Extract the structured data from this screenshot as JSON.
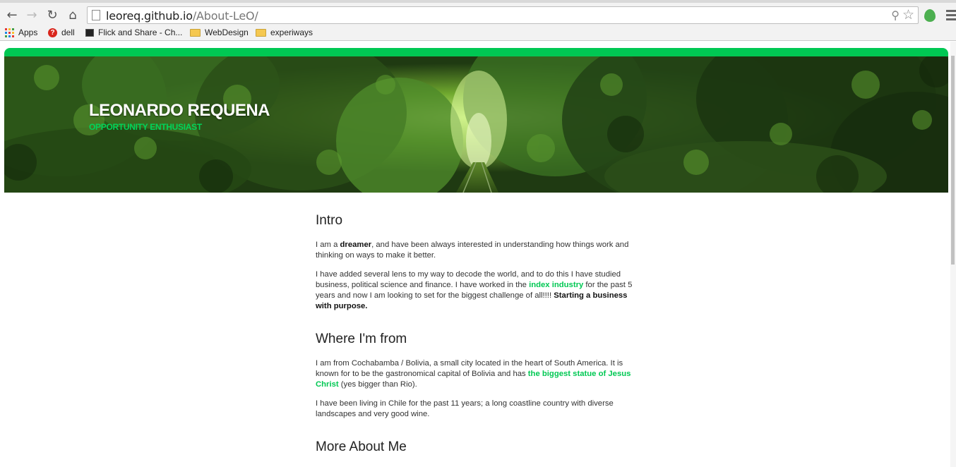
{
  "browser": {
    "url_host": "leoreq.github.io",
    "url_path": "/About-LeO/"
  },
  "bookmarks": {
    "apps": "Apps",
    "dell": "dell",
    "flick": "Flick and Share - Ch...",
    "webdesign": "WebDesign",
    "experiways": "experiways"
  },
  "hero": {
    "title": "LEONARDO REQUENA",
    "subtitle": "OPPORTUNITY ENTHUSIAST"
  },
  "intro": {
    "heading": "Intro",
    "p1_a": "I am a ",
    "p1_bold": "dreamer",
    "p1_b": ", and have been always interested in understanding how things work and thinking on ways to make it better.",
    "p2_a": "I have added several lens to my way to decode the world, and to do this I have studied business, political science and finance. I have worked in the ",
    "p2_link": "index industry",
    "p2_b": " for the past 5 years and now I am looking to set for the biggest challenge of all!!!! ",
    "p2_bold": "Starting a business with purpose."
  },
  "from": {
    "heading": "Where I'm from",
    "p1_a": "I am from Cochabamba / Bolivia, a small city located in the heart of South America. It is known for to be the gastronomical capital of Bolivia and has ",
    "p1_link": "the biggest statue of Jesus Christ",
    "p1_b": " (yes bigger than Rio).",
    "p2": "I have been living in Chile for the past 11 years; a long coastline country with diverse landscapes and very good wine."
  },
  "more": {
    "heading": "More About Me"
  },
  "colors": {
    "accent": "#00c853"
  }
}
